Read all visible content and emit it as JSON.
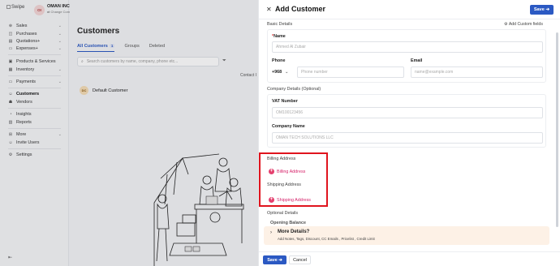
{
  "sidebar": {
    "logo_text": "Swipe",
    "org_initials": "OI",
    "org_name": "OMAN INC...",
    "org_change": "Change Company",
    "items": [
      {
        "label": "Sales",
        "icon": "cart-icon",
        "chevron": true
      },
      {
        "label": "Purchases",
        "icon": "bag-icon",
        "chevron": true
      },
      {
        "label": "Quotations+",
        "icon": "quote-icon",
        "chevron": true
      },
      {
        "label": "Expenses+",
        "icon": "wallet-icon",
        "chevron": true
      },
      {
        "label": "Products & Services",
        "icon": "box-icon",
        "chevron": false
      },
      {
        "label": "Inventory",
        "icon": "inventory-icon",
        "chevron": true
      },
      {
        "label": "Payments",
        "icon": "payment-icon",
        "chevron": true
      },
      {
        "label": "Customers",
        "icon": "user-icon",
        "chevron": false,
        "active": true
      },
      {
        "label": "Vendors",
        "icon": "vendor-icon",
        "chevron": false
      },
      {
        "label": "Insights",
        "icon": "insights-icon",
        "chevron": false
      },
      {
        "label": "Reports",
        "icon": "reports-icon",
        "chevron": false
      },
      {
        "label": "More",
        "icon": "more-icon",
        "chevron": true
      },
      {
        "label": "Invite Users",
        "icon": "invite-icon",
        "chevron": false
      },
      {
        "label": "Settings",
        "icon": "gear-icon",
        "chevron": false
      }
    ]
  },
  "page": {
    "title": "Customers",
    "tabs": [
      {
        "label": "All Customers",
        "count": "1"
      },
      {
        "label": "Groups"
      },
      {
        "label": "Deleted"
      }
    ],
    "search_placeholder": "Search customers by name, company, phone etc...",
    "contact_label": "Contact I",
    "customer_initials": "DC",
    "customer_name": "Default Customer"
  },
  "drawer": {
    "title": "Add Customer",
    "save_label": "Save",
    "basic_details": "Basic Details",
    "add_custom_fields": "Add Custom fields",
    "name_label": "Name",
    "name_placeholder": "Ahmed Al Zubair",
    "phone_label": "Phone",
    "country_code": "+968",
    "phone_placeholder": "Phone number",
    "email_label": "Email",
    "email_placeholder": "name@example.com",
    "company_details": "Company Details (Optional)",
    "vat_label": "VAT Number",
    "vat_placeholder": "OM100123456",
    "company_name_label": "Company Name",
    "company_name_placeholder": "OMAN TECH SOLUTIONS LLC",
    "billing_address_title": "Billing Address",
    "billing_address_button": "Billing Address",
    "shipping_address_title": "Shipping Address",
    "shipping_address_button": "Shipping Address",
    "optional_details": "Optional Details",
    "opening_balance": "Opening Balance",
    "more_details_title": "More Details?",
    "more_details_sub": "Add Notes, Tags, Discount, CC Emails , Pricelist , Credit Limit",
    "cancel_label": "Cancel"
  },
  "colors": {
    "primary": "#2b59c3",
    "accent_pink": "#d6246b",
    "highlight_red": "#e0141e",
    "more_details_bg": "#fdf1e6"
  }
}
